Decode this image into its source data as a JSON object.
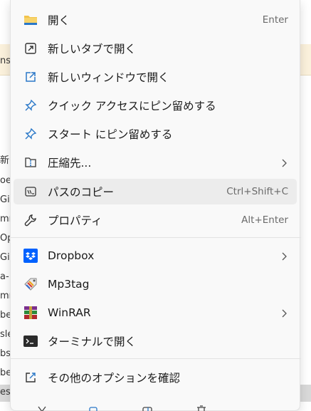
{
  "background": {
    "fragments": [
      "新",
      "oe",
      "Git",
      "mr",
      "Op",
      "Git",
      "a-",
      "mr",
      "be",
      "sle",
      "bs",
      "be",
      "es"
    ]
  },
  "menu": {
    "items": [
      {
        "label": "開く",
        "shortcut": "Enter",
        "icon": "folder-icon"
      },
      {
        "label": "新しいタブで開く",
        "shortcut": "",
        "icon": "open-in-new-tab-icon"
      },
      {
        "label": "新しいウィンドウで開く",
        "shortcut": "",
        "icon": "open-in-new-window-icon"
      },
      {
        "label": "クイック アクセスにピン留めする",
        "shortcut": "",
        "icon": "pin-icon"
      },
      {
        "label": "スタート にピン留めする",
        "shortcut": "",
        "icon": "pin-icon"
      },
      {
        "label": "圧縮先...",
        "shortcut": "",
        "icon": "zip-folder-icon",
        "submenu": true
      },
      {
        "label": "パスのコピー",
        "shortcut": "Ctrl+Shift+C",
        "icon": "copy-path-icon"
      },
      {
        "label": "プロパティ",
        "shortcut": "Alt+Enter",
        "icon": "wrench-icon"
      },
      {
        "label": "Dropbox",
        "shortcut": "",
        "icon": "dropbox-icon",
        "submenu": true
      },
      {
        "label": "Mp3tag",
        "shortcut": "",
        "icon": "mp3tag-icon"
      },
      {
        "label": "WinRAR",
        "shortcut": "",
        "icon": "winrar-icon",
        "submenu": true
      },
      {
        "label": "ターミナルで開く",
        "shortcut": "",
        "icon": "terminal-icon"
      },
      {
        "label": "その他のオプションを確認",
        "shortcut": "",
        "icon": "more-options-icon"
      }
    ],
    "bottom_icons": [
      "cut-icon",
      "copy-icon",
      "rename-icon",
      "delete-icon"
    ]
  },
  "colors": {
    "menu_bg": "#f9f9f9",
    "hover_bg": "#ececec",
    "accent_blue": "#2a78c8",
    "dropbox_blue": "#0061fe",
    "folder_yellow": "#f2c34b"
  }
}
